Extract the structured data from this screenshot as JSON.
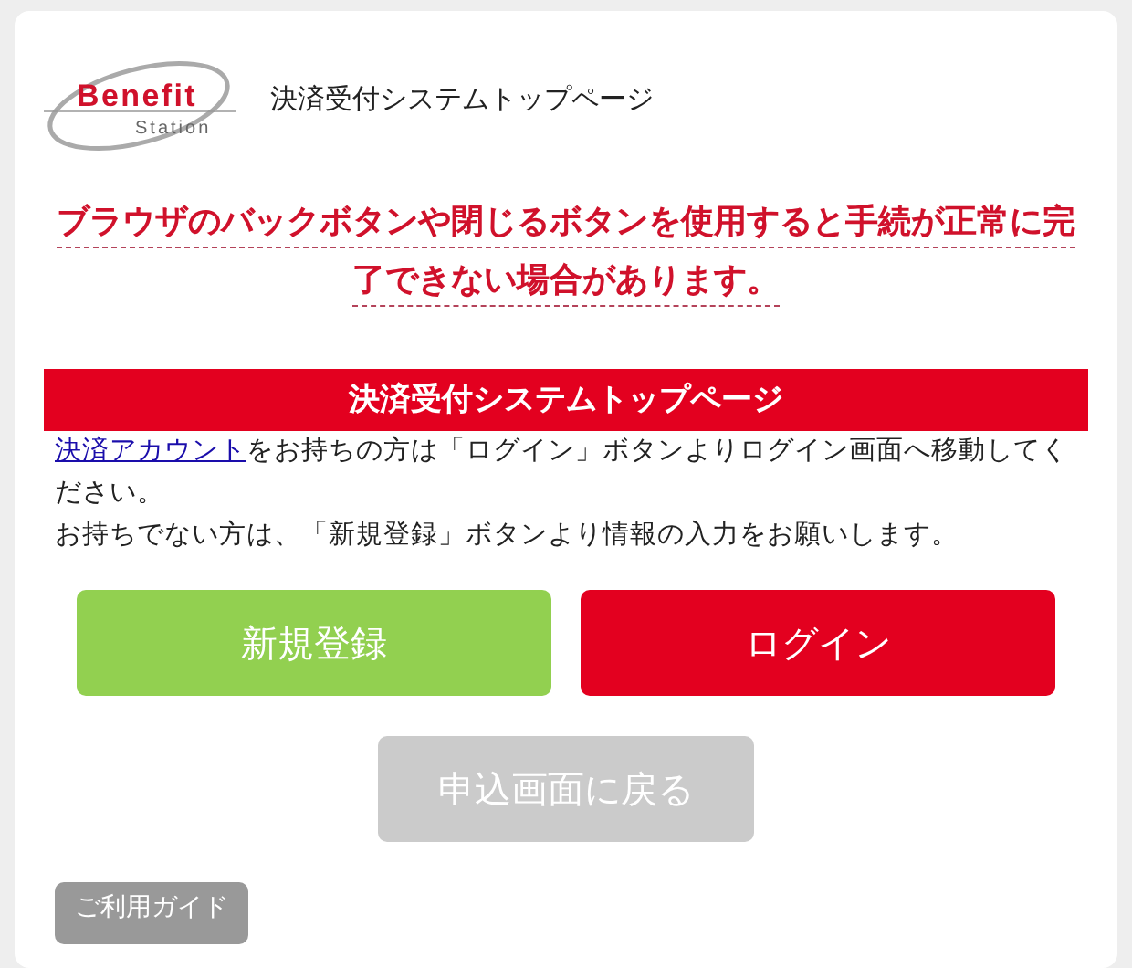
{
  "logo": {
    "word_1": "Benefit",
    "word_2": "Station"
  },
  "header": {
    "title": "決済受付システムトップページ"
  },
  "warning": "ブラウザのバックボタンや閉じるボタンを使用すると手続が正常に完了できない場合があります。",
  "banner": "決済受付システムトップページ",
  "intro": {
    "link": "決済アカウント",
    "text": "をお持ちの方は「ログイン」ボタンよりログイン画面へ移動してください。"
  },
  "note": "お持ちでない方は、「新規登録」ボタンより情報の入力をお願いします。",
  "buttons": [
    {
      "label": "新規登録",
      "kind": "register"
    },
    {
      "label": "ログイン",
      "kind": "login"
    }
  ],
  "back_button": {
    "label": "申込画面に戻る",
    "disabled": true
  },
  "guide_button": "ご利用ガイド"
}
